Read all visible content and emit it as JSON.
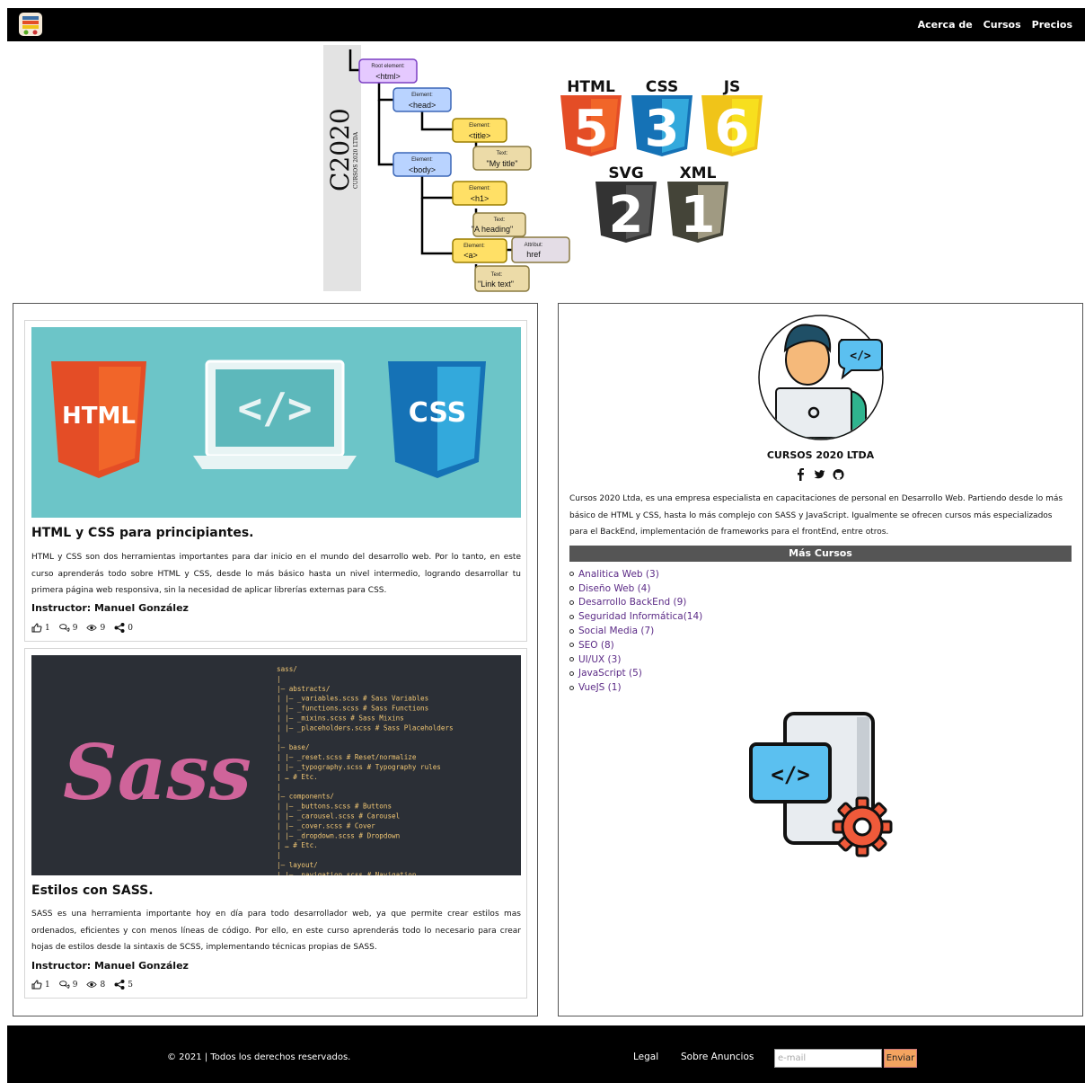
{
  "nav": {
    "logo_icon": "books-logo-icon",
    "links": [
      "Acerca de",
      "Cursos",
      "Precios"
    ]
  },
  "hero": {
    "tree": {
      "brand_big": "C2020",
      "brand_small": "CURSOS 2020 LTDA",
      "nodes": [
        {
          "small": "Root element:",
          "main": "<html>"
        },
        {
          "small": "Element:",
          "main": "<head>"
        },
        {
          "small": "Element:",
          "main": "<title>"
        },
        {
          "small": "Text:",
          "main": "\"My title\""
        },
        {
          "small": "Element:",
          "main": "<body>"
        },
        {
          "small": "Element:",
          "main": "<h1>"
        },
        {
          "small": "Text:",
          "main": "\"A heading\""
        },
        {
          "small": "Element:",
          "main": "<a>"
        },
        {
          "small": "Attribut:",
          "main": "href"
        },
        {
          "small": "Text:",
          "main": "\"Link text\""
        }
      ]
    },
    "badges": [
      {
        "label": "HTML",
        "number": "5",
        "color": "#e44d26",
        "dark": "#f16529"
      },
      {
        "label": "CSS",
        "number": "3",
        "color": "#1572b6",
        "dark": "#33a9dc"
      },
      {
        "label": "JS",
        "number": "6",
        "color": "#f0c419",
        "dark": "#f7df1e"
      },
      {
        "label": "SVG",
        "number": "2",
        "color": "#333333",
        "dark": "#555555"
      },
      {
        "label": "XML",
        "number": "1",
        "color": "#444438",
        "dark": "#a09a82"
      }
    ]
  },
  "courses": [
    {
      "title": "HTML y CSS para principiantes.",
      "description": "HTML y CSS son dos herramientas importantes para dar inicio en el mundo del desarrollo web. Por lo tanto, en este curso aprenderás todo sobre HTML y CSS, desde lo más básico hasta un nivel intermedio, logrando desarrollar tu primera página web responsiva, sin la necesidad de aplicar librerías externas para CSS.",
      "instructor": "Instructor: Manuel González",
      "likes": "1",
      "comments": "9",
      "views": "9",
      "shares": "0",
      "image": {
        "left_label": "HTML",
        "code": "</>",
        "right_label": "CSS"
      }
    },
    {
      "title": "Estilos con SASS.",
      "description": "SASS es una herramienta importante hoy en día para todo desarrollador web, ya que permite crear estilos mas ordenados, eficientes y con menos líneas de código. Por ello, en este curso aprenderás todo lo necesario para crear hojas de estilos desde la sintaxis de SCSS, implementando técnicas propias de SASS.",
      "instructor": "Instructor: Manuel González",
      "likes": "1",
      "comments": "9",
      "views": "8",
      "shares": "5",
      "image": {
        "logo": "Sass",
        "code_lines": [
          "sass/",
          "|",
          "|– abstracts/",
          "|   |– _variables.scss    # Sass Variables",
          "|   |– _functions.scss    # Sass Functions",
          "|   |– _mixins.scss       # Sass Mixins",
          "|   |– _placeholders.scss # Sass Placeholders",
          "|",
          "|– base/",
          "|   |– _reset.scss        # Reset/normalize",
          "|   |– _typography.scss   # Typography rules",
          "|   …                     # Etc.",
          "|",
          "|– components/",
          "|   |– _buttons.scss      # Buttons",
          "|   |– _carousel.scss     # Carousel",
          "|   |– _cover.scss        # Cover",
          "|   |– _dropdown.scss     # Dropdown",
          "|   …                     # Etc.",
          "|",
          "|– layout/",
          "|   |– _navigation.scss   # Navigation"
        ]
      }
    }
  ],
  "sidebar": {
    "company": "CURSOS 2020 LTDA",
    "social_icons": [
      "facebook-icon",
      "twitter-icon",
      "github-icon"
    ],
    "about": "Cursos 2020 Ltda, es una empresa especialista en capacitaciones de personal en Desarrollo Web. Partiendo desde lo más básico de HTML y CSS, hasta lo más complejo con SASS y JavaScript. Igualmente se ofrecen cursos más especializados para el BackEnd, implementación de frameworks para el frontEnd, entre otros.",
    "more_title": "Más Cursos",
    "more_courses": [
      "Analitica Web (3)",
      "Diseño Web (4)",
      "Desarrollo BackEnd (9)",
      "Seguridad Informática(14)",
      "Social Media (7)",
      "SEO (8)",
      "UI/UX (3)",
      "JavaScript (5)",
      "VueJS (1)"
    ],
    "dev_icon_code": "</>"
  },
  "footer": {
    "copyright": "© 2021 | Todos los derechos reservados.",
    "legal": "Legal",
    "ads": "Sobre Anuncios",
    "email_placeholder": "e-mail",
    "send_label": "Enviar"
  },
  "colors": {
    "nav_bg": "#000000",
    "link_purple": "#5b2a86",
    "bar_gray": "#555555",
    "send_orange": "#f4a460"
  }
}
